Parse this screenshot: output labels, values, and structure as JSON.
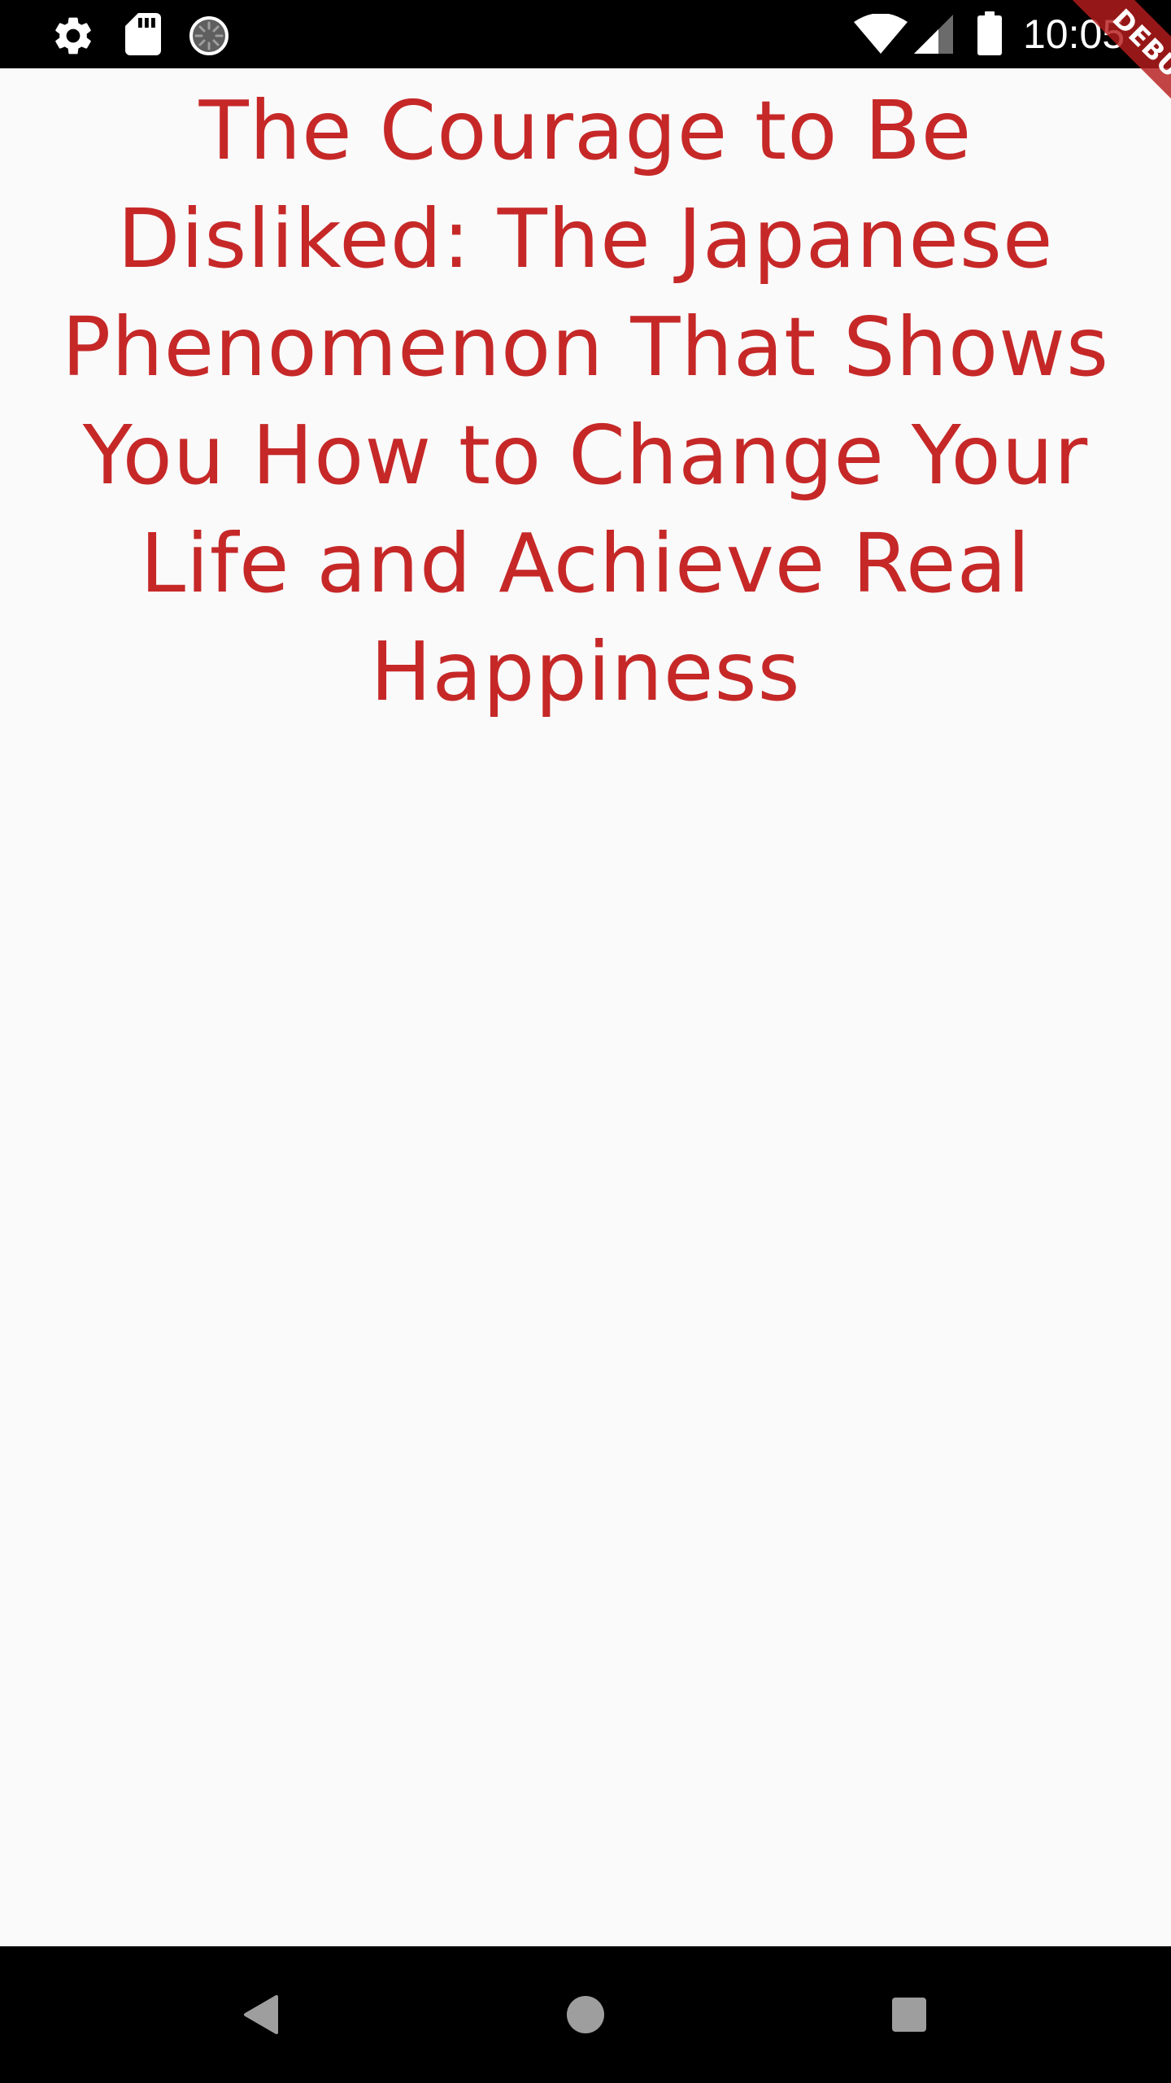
{
  "status_bar": {
    "time": "10:05",
    "icons": {
      "left": [
        "settings-icon",
        "sd-card-icon",
        "sync-icon"
      ],
      "right": [
        "wifi-icon",
        "cell-signal-icon",
        "battery-icon"
      ]
    }
  },
  "debug_banner": {
    "label": "DEBUG",
    "color": "#b71c1c"
  },
  "book": {
    "title": "The Courage to Be Disliked: The Japanese Phenomenon That Shows You How to Change Your Life and Achieve Real Happiness",
    "title_color": "#c62828"
  },
  "navigation_bar": {
    "buttons": [
      "back-icon",
      "home-icon",
      "recent-apps-icon"
    ]
  },
  "colors": {
    "background": "#fafafa",
    "system_bars": "#000000"
  }
}
